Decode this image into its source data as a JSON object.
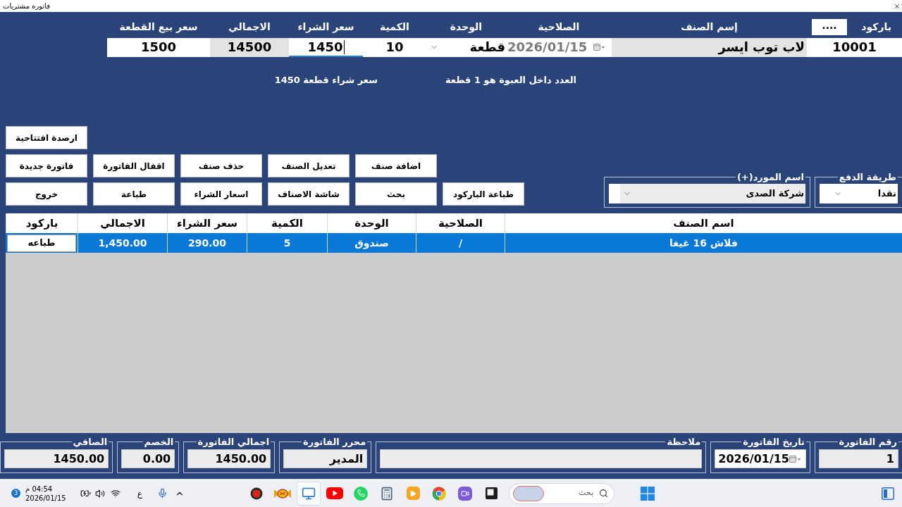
{
  "window": {
    "title": "فاتوره مشتريات"
  },
  "item_entry": {
    "browse_button": "....",
    "fields": [
      {
        "label": "باركود",
        "kind": "number",
        "value": "10001",
        "readonly": false,
        "disabled": false,
        "focused": false
      },
      {
        "label": "إسم الصنف",
        "kind": "text",
        "value": "لاب توب ايسر",
        "readonly": true,
        "disabled": false,
        "focused": false
      },
      {
        "label": "الصلاحية",
        "kind": "date",
        "value": "2026/01/15",
        "readonly": false,
        "disabled": true,
        "focused": false
      },
      {
        "label": "الوحدة",
        "kind": "combo",
        "value": "قطعة",
        "readonly": false,
        "disabled": false,
        "focused": false
      },
      {
        "label": "الكمية",
        "kind": "number",
        "value": "10",
        "readonly": false,
        "disabled": false,
        "focused": false
      },
      {
        "label": "سعر الشراء",
        "kind": "number",
        "value": "1450",
        "readonly": false,
        "disabled": false,
        "focused": true
      },
      {
        "label": "الاجمالي",
        "kind": "number",
        "value": "14500",
        "readonly": true,
        "disabled": false,
        "focused": false
      },
      {
        "label": "سعر بيع القطعة",
        "kind": "number",
        "value": "1500",
        "readonly": false,
        "disabled": false,
        "focused": false
      }
    ]
  },
  "info": [
    "العدد داخل العبوة هو 1 قطعة",
    "سعر شراء قطعة 1450"
  ],
  "opening_balance_button": "ارصدة افتتاحية",
  "action_rows": [
    [
      "اضافة صنف",
      "تعديل الصنف",
      "حذف صنف",
      "اقفال الفاتورة",
      "فاتورة جديدة"
    ],
    [
      "طباعة الباركود",
      "بحث",
      "شاشة الاصناف",
      "اسعار الشراء",
      "طباعة",
      "خروج"
    ]
  ],
  "selectors": [
    {
      "label": "طريقة الدفع",
      "value": "نقدا",
      "readonly": false
    },
    {
      "label": "اسم المورد(+)",
      "value": "شركة الصدى",
      "readonly": true
    }
  ],
  "table": {
    "columns": [
      "اسم الصنف",
      "الصلاحية",
      "الوحدة",
      "الكمية",
      "سعر الشراء",
      "الاجمالي",
      "باركود"
    ],
    "rows": [
      {
        "selected": true,
        "cells": [
          "فلاش 16 غيغا",
          "/",
          "صندوق",
          "5",
          "290.00",
          "1,450.00"
        ],
        "print_button": "طباعه"
      }
    ]
  },
  "totals": [
    {
      "label": "رقم الفاتورة",
      "kind": "text",
      "value": "1",
      "readonly": true
    },
    {
      "label": "تاريخ الفاتورة",
      "kind": "date",
      "value": "2026/01/15",
      "readonly": false
    },
    {
      "label": "ملاحظة",
      "kind": "text",
      "readonly": true
    },
    {
      "label": "محرر الفاتورة",
      "kind": "text",
      "value": "المدير",
      "readonly": true
    },
    {
      "label": "اجمالي الفاتورة",
      "kind": "text",
      "value": "1450.00",
      "readonly": true
    },
    {
      "label": "الخصم",
      "kind": "text",
      "value": "0.00",
      "readonly": true
    },
    {
      "label": "الصافي",
      "kind": "text",
      "value": "1450.00",
      "readonly": true
    }
  ],
  "taskbar": {
    "notification_count": "3",
    "time": "04:54 م",
    "date": "2026/01/15",
    "language": "ع",
    "apps": [
      {
        "selected": false
      },
      {
        "selected": false
      },
      {
        "selected": true
      },
      {
        "selected": false
      },
      {
        "selected": false
      },
      {
        "selected": false
      },
      {
        "selected": false
      },
      {
        "selected": false
      },
      {
        "selected": false
      },
      {
        "selected": false
      }
    ],
    "search": {
      "placeholder": "بحث"
    }
  }
}
